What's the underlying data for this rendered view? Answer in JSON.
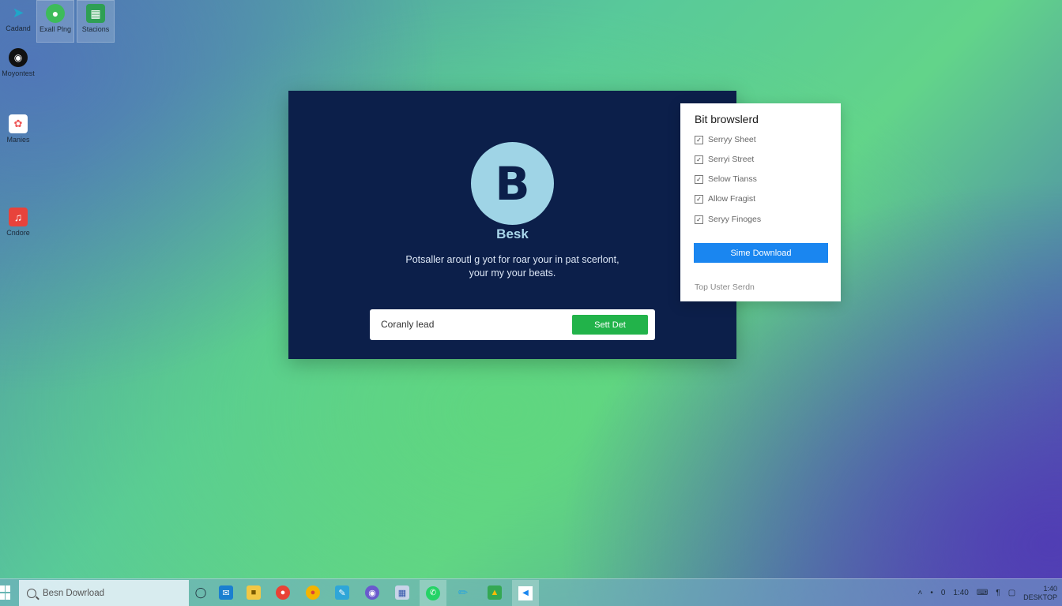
{
  "desktop": {
    "icons": [
      {
        "label": "Cadand",
        "icon": "teal-arrow-icon"
      },
      {
        "label": "Exall Plng",
        "icon": "green-chat-icon"
      },
      {
        "label": "Stacions",
        "icon": "green-doc-icon"
      },
      {
        "label": "Moyontest",
        "icon": "black-circle-icon"
      },
      {
        "label": "Manies",
        "icon": "photos-pinwheel-icon"
      },
      {
        "label": "Cndore",
        "icon": "red-music-icon"
      }
    ]
  },
  "main_card": {
    "logo_letter": "B",
    "app_name": "Besk",
    "tagline_line1": "Potsaller aroutl g yot for roar your in pat scerlont,",
    "tagline_line2": "your my your beats.",
    "input_value": "Coranly lead",
    "set_button": "Sett Det"
  },
  "side_panel": {
    "title": "Bit browslerd",
    "options": [
      {
        "label": "Serryy Sheet",
        "checked": true
      },
      {
        "label": "Serryi Street",
        "checked": true
      },
      {
        "label": "Selow Tianss",
        "checked": true
      },
      {
        "label": "Allow Fragist",
        "checked": true
      },
      {
        "label": "Seryy Finoges",
        "checked": true
      }
    ],
    "download_button": "Sime Download",
    "footer": "Top Uster Serdn"
  },
  "taskbar": {
    "search_placeholder": "Besn Dowrload",
    "tray": {
      "time": "1:40",
      "indicator": "0",
      "clock_line1": "1:40",
      "clock_line2": "DESKTOP"
    }
  },
  "colors": {
    "card_bg": "#0c1f4a",
    "logo_bg": "#9fd4e6",
    "green_button": "#22b34a",
    "blue_button": "#1a86f0"
  }
}
